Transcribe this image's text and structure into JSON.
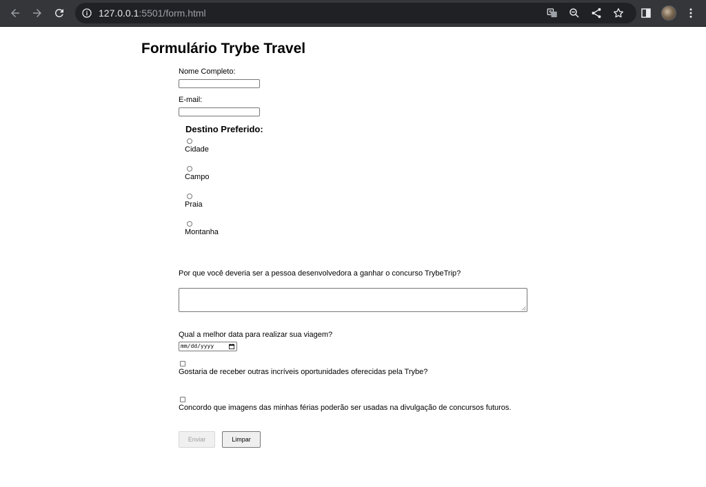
{
  "browser": {
    "url_host": "127.0.0.1",
    "url_rest": ":5501/form.html"
  },
  "form": {
    "title": "Formulário Trybe Travel",
    "name_label": "Nome Completo:",
    "name_value": "",
    "email_label": "E-mail:",
    "email_value": "",
    "destination": {
      "legend": "Destino Preferido:",
      "options": [
        {
          "label": "Cidade",
          "checked": false
        },
        {
          "label": "Campo",
          "checked": false
        },
        {
          "label": "Praia",
          "checked": false
        },
        {
          "label": "Montanha",
          "checked": false
        }
      ]
    },
    "why_label": "Por que você deveria ser a pessoa desenvolvedora a ganhar o concurso TrybeTrip?",
    "why_value": "",
    "date_label": "Qual a melhor data para realizar sua viagem?",
    "date_placeholder": "mm/dd/yyyy",
    "opt_in": {
      "label": "Gostaria de receber outras incríveis oportunidades oferecidas pela Trybe?",
      "checked": false
    },
    "consent": {
      "label": "Concordo que imagens das minhas férias poderão ser usadas na divulgação de concursos futuros.",
      "checked": false
    },
    "submit_label": "Enviar",
    "submit_disabled": true,
    "reset_label": "Limpar"
  }
}
